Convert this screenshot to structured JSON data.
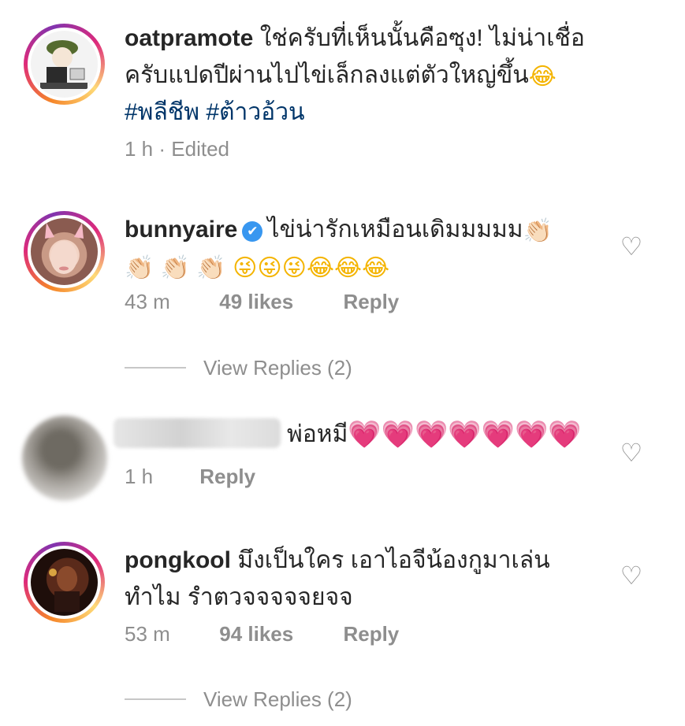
{
  "comments": [
    {
      "username": "oatpramote",
      "text_line1": "ใช่ครับที่เห็นนั้นคือซุง! ไม่น่าเชื่อ",
      "text_line2": "ครับแปดปีผ่านไปไข่เล็กลงแต่ตัวใหญ่ขึ้น",
      "emoji_end": "😂",
      "hashtags": [
        "#พลีชีพ",
        "#ต้าวอ้วน"
      ],
      "time": "1 h",
      "edited": "· Edited"
    },
    {
      "username": "bunnyaire",
      "verified_icon": "✔",
      "text_line1": "ไข่น่ารักเหมือนเดิมมมมม",
      "emoji_line1": "👏🏻",
      "emoji_line2": [
        "👏🏻",
        "👏🏻",
        "👏🏻",
        "😜",
        "😜",
        "😜",
        "😂",
        "😂",
        "😂"
      ],
      "time": "43 m",
      "likes": "49 likes",
      "reply": "Reply",
      "view_replies": "View Replies (2)"
    },
    {
      "username": "",
      "text_line1": "พ่อหมี",
      "hearts": [
        "💗",
        "💗",
        "💗",
        "💗",
        "💗",
        "💗",
        "💗"
      ],
      "time": "1 h",
      "reply": "Reply"
    },
    {
      "username": "pongkool",
      "text_line1": "มึงเป็นใคร เอาไอจีน้องกูมาเล่น",
      "text_line2": "ทำไม รำตวจจจจจยจจ",
      "time": "53 m",
      "likes": "94 likes",
      "reply": "Reply",
      "view_replies": "View Replies (2)"
    }
  ],
  "icons": {
    "like": "♡"
  },
  "colors": {
    "username": "#262626",
    "hashtag": "#003569",
    "meta": "#8e8e8e",
    "verified": "#3897f0"
  }
}
